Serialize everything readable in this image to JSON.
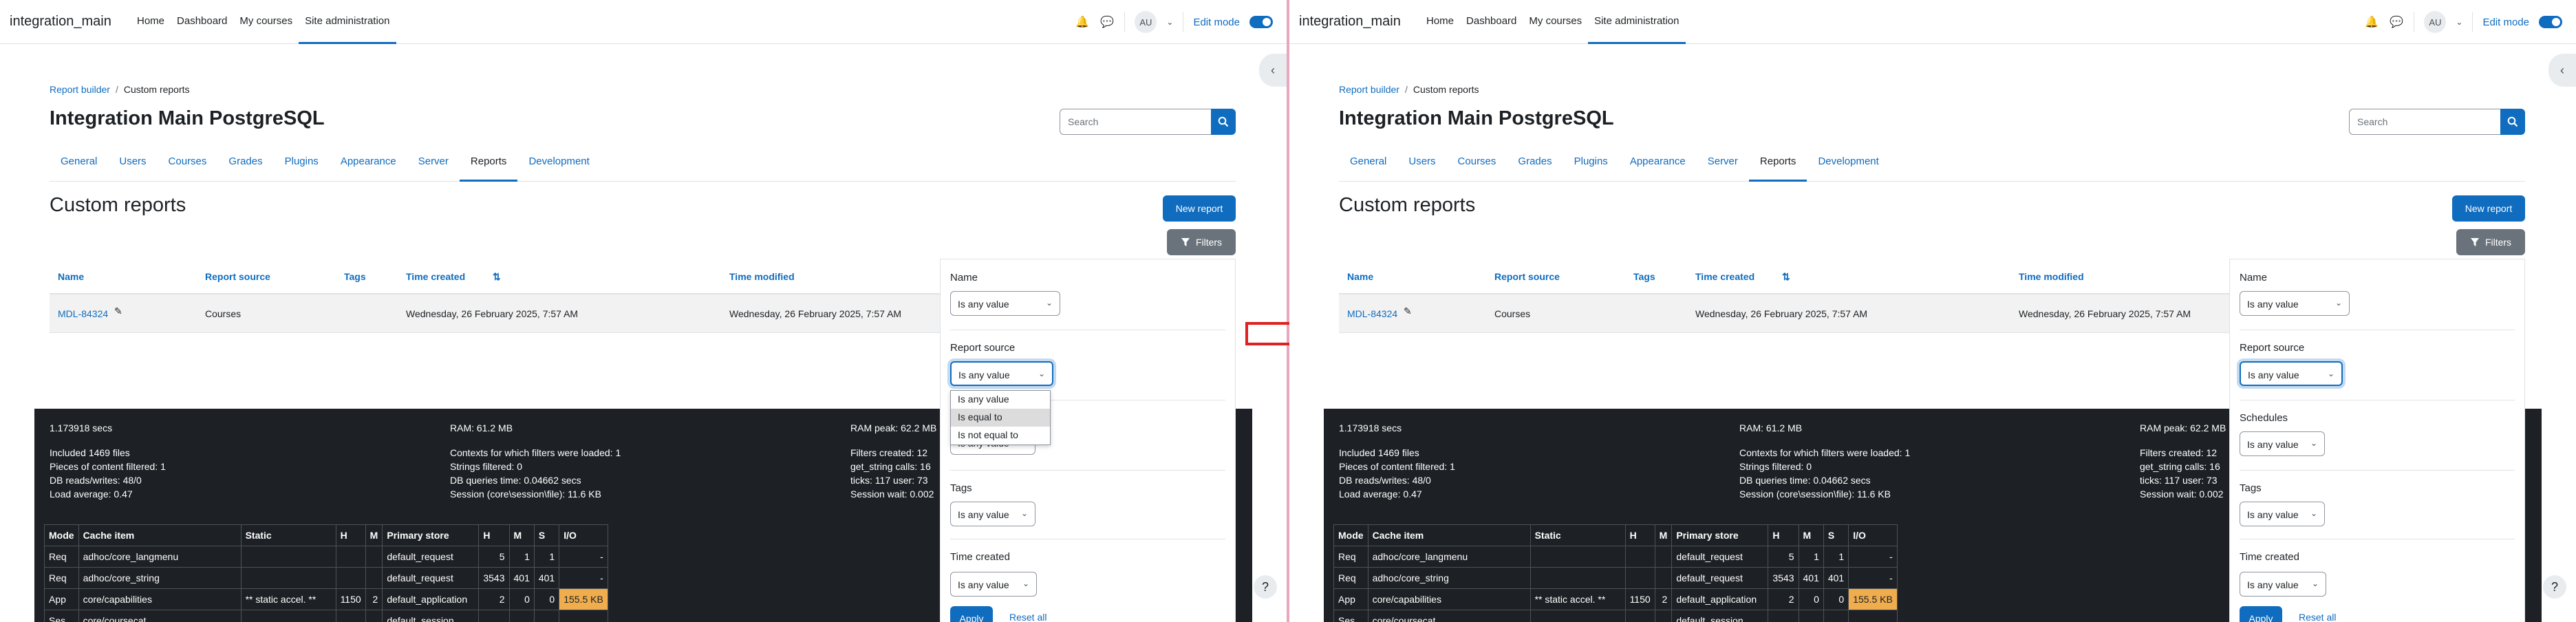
{
  "site_name": "integration_main",
  "nav": {
    "links": [
      "Home",
      "Dashboard",
      "My courses",
      "Site administration"
    ],
    "active_index": 3,
    "avatar": "AU",
    "edit_mode_label": "Edit mode"
  },
  "breadcrumb": {
    "link": "Report builder",
    "separator": "/",
    "current": "Custom reports"
  },
  "page_title": "Integration Main PostgreSQL",
  "search": {
    "placeholder": "Search"
  },
  "tabs": [
    "General",
    "Users",
    "Courses",
    "Grades",
    "Plugins",
    "Appearance",
    "Server",
    "Reports",
    "Development"
  ],
  "active_tab": 7,
  "section_title": "Custom reports",
  "new_report_label": "New report",
  "filters_button_label": "Filters",
  "table": {
    "headers": [
      "Name",
      "Report source",
      "Tags",
      "Time created",
      "Time modified"
    ],
    "rows": [
      {
        "name": "MDL-84324",
        "source": "Courses",
        "tags": "",
        "created": "Wednesday, 26 February 2025, 7:57 AM",
        "modified": "Wednesday, 26 February 2025, 7:57 AM"
      }
    ]
  },
  "filters": {
    "name_label": "Name",
    "report_source_label": "Report source",
    "schedules_label": "Schedules",
    "tags_label": "Tags",
    "time_created_label": "Time created",
    "select_value": "Is any value",
    "dropdown_options": [
      "Is any value",
      "Is equal to",
      "Is not equal to"
    ],
    "apply_label": "Apply",
    "reset_label": "Reset all"
  },
  "perf": {
    "time": "1.173918 secs",
    "ram": "RAM: 61.2 MB",
    "ram_peak": "RAM peak: 62.2 MB",
    "included_files": "Included 1469 files",
    "pieces_filtered": "Pieces of content filtered: 1",
    "db_rw": "DB reads/writes: 48/0",
    "load_avg": "Load average: 0.47",
    "contexts": "Contexts for which filters were loaded: 1",
    "strings_filtered": "Strings filtered: 0",
    "db_time": "DB queries time: 0.04662 secs",
    "session": "Session (core\\session\\file): 11.6 KB",
    "filters_created": "Filters created: 12",
    "get_string": "get_string calls: 16",
    "ticks": "ticks: 117 user: 73",
    "session_wait": "Session wait: 0.002",
    "cache_headers": [
      "Mode",
      "Cache item",
      "Static",
      "H",
      "M",
      "Primary store",
      "H",
      "M",
      "S",
      "I/O"
    ],
    "cache_rows": [
      [
        "Req",
        "adhoc/core_langmenu",
        "",
        "",
        "",
        "default_request",
        "5",
        "1",
        "1",
        "-"
      ],
      [
        "Req",
        "adhoc/core_string",
        "",
        "",
        "",
        "default_request",
        "3543",
        "401",
        "401",
        "-"
      ],
      [
        "App",
        "core/capabilities",
        "** static accel. **",
        "1150",
        "2",
        "default_application",
        "2",
        "0",
        "0",
        "155.5 KB"
      ],
      [
        "Ses",
        "core/coursecat",
        "",
        "",
        "",
        "default_session",
        "",
        "",
        "",
        ""
      ]
    ]
  }
}
